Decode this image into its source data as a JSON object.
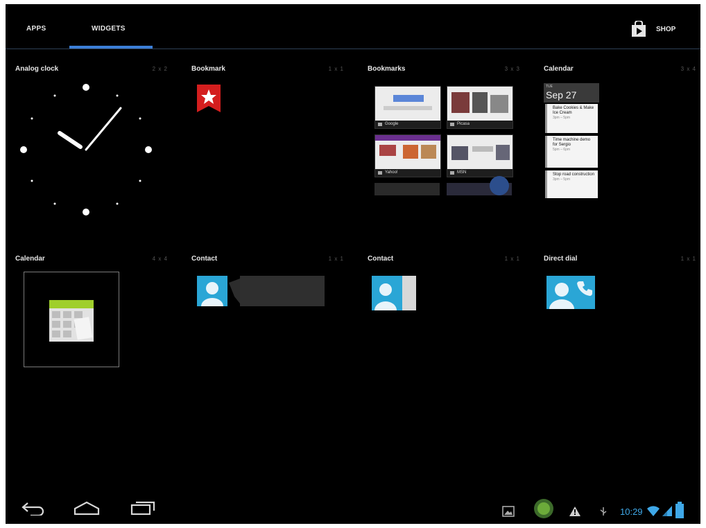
{
  "tabs": [
    {
      "label": "APPS",
      "selected": false
    },
    {
      "label": "WIDGETS",
      "selected": true
    }
  ],
  "shop": {
    "label": "SHOP",
    "icon": "play-store-bag-icon"
  },
  "accent_color": "#3c7fd8",
  "widgets": [
    {
      "title": "Analog clock",
      "size": "2 x 2"
    },
    {
      "title": "Bookmark",
      "size": "1 x 1"
    },
    {
      "title": "Bookmarks",
      "size": "3 x 3"
    },
    {
      "title": "Calendar",
      "size": "3 x 4"
    },
    {
      "title": "Calendar",
      "size": "4 x 4"
    },
    {
      "title": "Contact",
      "size": "1 x 1"
    },
    {
      "title": "Contact",
      "size": "1 x 1"
    },
    {
      "title": "Direct dial",
      "size": "1 x 1"
    }
  ],
  "bookmarks": [
    "Google",
    "Picasa",
    "Yahoo!",
    "MSN"
  ],
  "calendar_preview": {
    "day": "TUE",
    "date": "Sep 27",
    "events": [
      {
        "title": "Bake Cookies & Make Ice Cream",
        "sub": "3pm – 5pm"
      },
      {
        "title": "Time machine demo for Sergio",
        "sub": "5pm – 6pm"
      },
      {
        "title": "Stop road construction",
        "sub": "3pm – 5pm"
      }
    ]
  },
  "status": {
    "time": "10:29"
  },
  "nav_icons": [
    "back-icon",
    "home-icon",
    "recent-apps-icon"
  ]
}
